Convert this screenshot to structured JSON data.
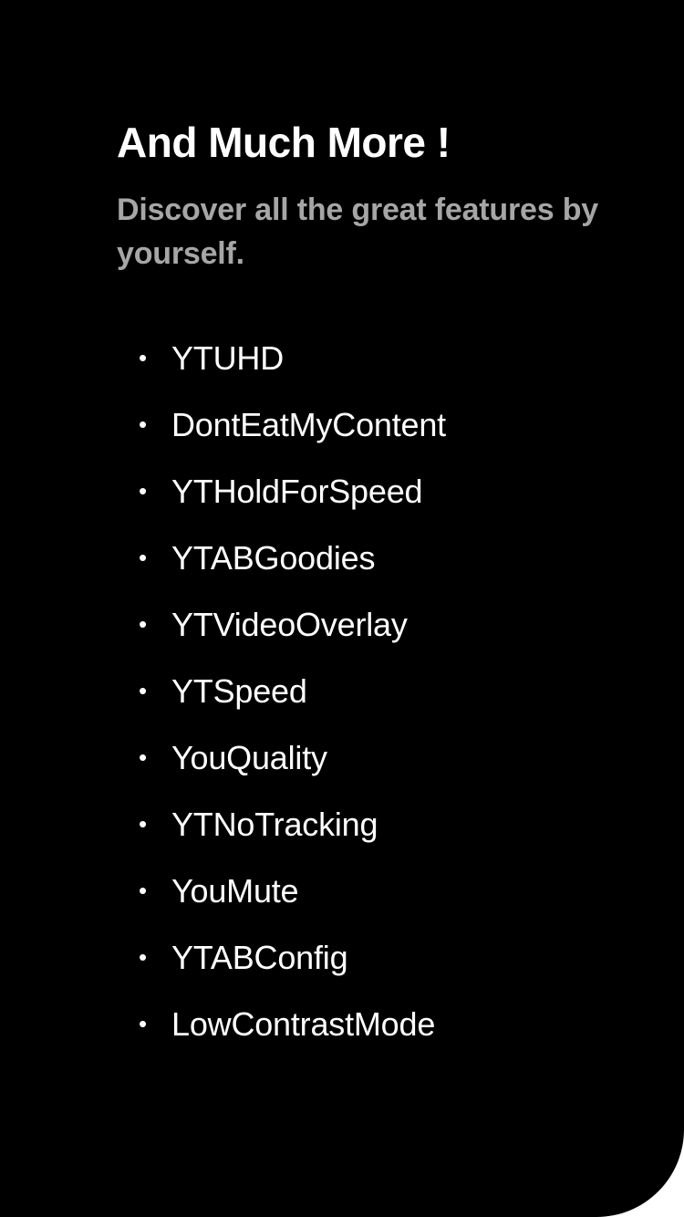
{
  "page": {
    "title": "And Much More !",
    "subtitle": "Discover all the great features by yourself."
  },
  "features": [
    {
      "label": "YTUHD"
    },
    {
      "label": "DontEatMyContent"
    },
    {
      "label": "YTHoldForSpeed"
    },
    {
      "label": "YTABGoodies"
    },
    {
      "label": "YTVideoOverlay"
    },
    {
      "label": "YTSpeed"
    },
    {
      "label": "YouQuality"
    },
    {
      "label": "YTNoTracking"
    },
    {
      "label": "YouMute"
    },
    {
      "label": "YTABConfig"
    },
    {
      "label": "LowContrastMode"
    }
  ],
  "icons": {
    "bullet": "•"
  },
  "colors": {
    "background": "#000000",
    "title": "#ffffff",
    "subtitle": "#a6a6a6",
    "item": "#ffffff"
  }
}
